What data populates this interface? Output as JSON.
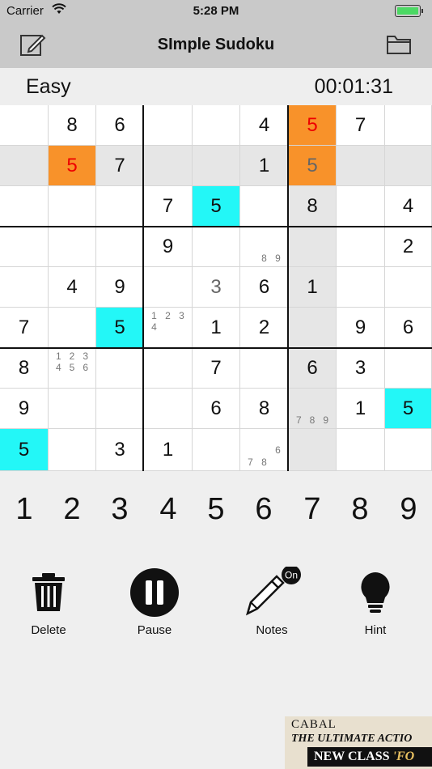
{
  "status_bar": {
    "carrier": "Carrier",
    "time": "5:28 PM"
  },
  "nav": {
    "title": "SImple Sudoku",
    "left_icon": "edit-icon",
    "right_icon": "folder-icon"
  },
  "game": {
    "level": "Easy",
    "timer": "00:01:31"
  },
  "colors": {
    "selected_cell": "#f8922a",
    "error_digit": "#e00000",
    "matched_digit": "#23f7f7",
    "highlight": "#e6e6e6",
    "bar": "#c9c9c9"
  },
  "board": [
    [
      "",
      "8",
      "6",
      "",
      "",
      "4",
      "5",
      "7",
      ""
    ],
    [
      "",
      "5",
      "7",
      "",
      "",
      "1",
      "5",
      "",
      ""
    ],
    [
      "",
      "",
      "",
      "7",
      "5",
      "",
      "8",
      "",
      "4"
    ],
    [
      "",
      "",
      "",
      "9",
      "",
      "",
      "",
      "",
      "2"
    ],
    [
      "",
      "4",
      "9",
      "",
      "3",
      "6",
      "1",
      "",
      ""
    ],
    [
      "7",
      "",
      "5",
      "",
      "1",
      "2",
      "",
      "9",
      "6"
    ],
    [
      "8",
      "",
      "",
      "",
      "7",
      "",
      "6",
      "3",
      ""
    ],
    [
      "9",
      "",
      "",
      "",
      "6",
      "8",
      "",
      "1",
      "5"
    ],
    [
      "5",
      "",
      "3",
      "1",
      "",
      "",
      "",
      "",
      ""
    ]
  ],
  "cell_styles": [
    {
      "r": 0,
      "c": 6,
      "style": "orange",
      "text": "err"
    },
    {
      "r": 1,
      "c": 1,
      "style": "orange",
      "text": "err"
    },
    {
      "r": 1,
      "c": 6,
      "style": "orange",
      "text": "user"
    },
    {
      "r": 2,
      "c": 4,
      "style": "cyan"
    },
    {
      "r": 5,
      "c": 2,
      "style": "cyan"
    },
    {
      "r": 7,
      "c": 8,
      "style": "cyan"
    },
    {
      "r": 8,
      "c": 0,
      "style": "cyan"
    },
    {
      "r": 4,
      "c": 4,
      "text": "user"
    }
  ],
  "highlighted_row": 1,
  "highlighted_col": 6,
  "pencil_notes": [
    {
      "r": 3,
      "c": 5,
      "digits": [
        "8",
        "9"
      ]
    },
    {
      "r": 5,
      "c": 3,
      "digits": [
        "1",
        "2",
        "3",
        "4"
      ]
    },
    {
      "r": 6,
      "c": 1,
      "digits": [
        "1",
        "2",
        "3",
        "4",
        "5",
        "6"
      ]
    },
    {
      "r": 7,
      "c": 6,
      "digits": [
        "7",
        "8",
        "9"
      ]
    },
    {
      "r": 8,
      "c": 5,
      "digits": [
        "6",
        "7",
        "8"
      ]
    }
  ],
  "numpad": [
    "1",
    "2",
    "3",
    "4",
    "5",
    "6",
    "7",
    "8",
    "9"
  ],
  "tools": {
    "delete": "Delete",
    "pause": "Pause",
    "notes": "Notes",
    "notes_badge": "On",
    "hint": "Hint"
  },
  "ad": {
    "brand": "CABAL",
    "line1": "THE ULTIMATE ACTIO",
    "line2a": "NEW CLASS ",
    "line2b": "'FO"
  }
}
